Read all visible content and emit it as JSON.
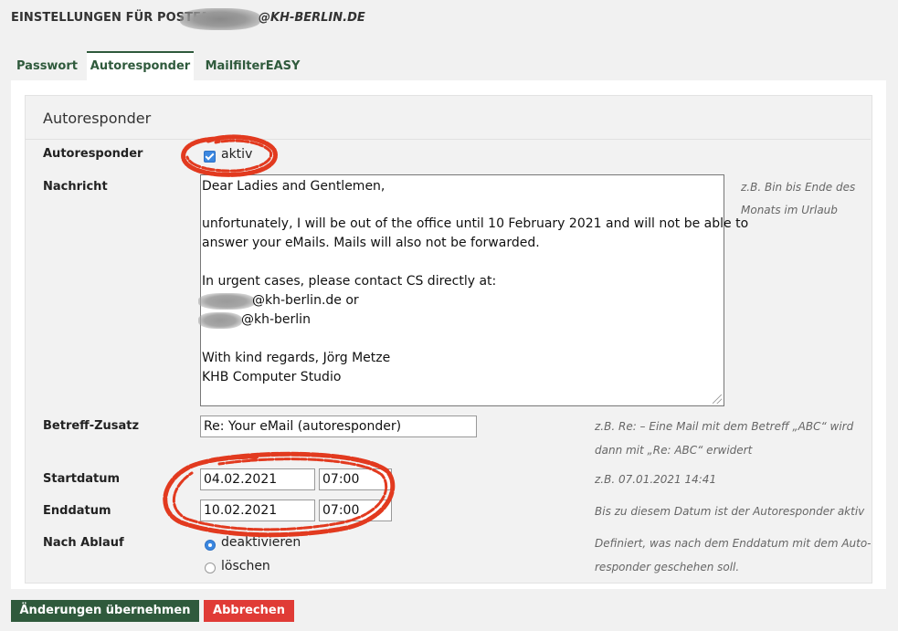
{
  "header": {
    "title": "EINSTELLUNGEN FÜR POSTFACH",
    "domain": "@KH-BERLIN.DE"
  },
  "tabs": [
    {
      "label": "Passwort"
    },
    {
      "label": "Autoresponder"
    },
    {
      "label": "MailfilterEASY"
    }
  ],
  "active_tab": "Autoresponder",
  "panel": {
    "title": "Autoresponder"
  },
  "form": {
    "autoresponder": {
      "label": "Autoresponder",
      "checkbox_label": "aktiv",
      "checked": true
    },
    "message": {
      "label": "Nachricht",
      "lines": [
        "Dear Ladies and Gentlemen,",
        "",
        "unfortunately, I will be out of the office until 10 February 2021 and will not be able to",
        "answer your eMails. Mails will also not be forwarded.",
        "",
        "In urgent cases, please contact CS directly at:",
        "@kh-berlin.de or",
        "@kh-berlin",
        "",
        "With kind regards, Jörg Metze",
        "KHB Computer Studio"
      ],
      "hint_line1": "z.B. Bin bis Ende des",
      "hint_line2": "Monats im Urlaub"
    },
    "subject": {
      "label": "Betreff-Zusatz",
      "value": "Re: Your eMail (autoresponder)",
      "hint_line1": "z.B. Re: – Eine Mail mit dem Betreff „ABC“ wird",
      "hint_line2": "dann mit „Re: ABC“ erwidert"
    },
    "start": {
      "label": "Startdatum",
      "date": "04.02.2021",
      "time": "07:00",
      "hint": "z.B. 07.01.2021 14:41"
    },
    "end": {
      "label": "Enddatum",
      "date": "10.02.2021",
      "time": "07:00",
      "hint": "Bis zu diesem Datum ist der Autoresponder aktiv"
    },
    "after": {
      "label": "Nach Ablauf",
      "options": [
        "deaktivieren",
        "löschen"
      ],
      "selected": "deaktivieren",
      "hint_line1": "Definiert, was nach dem Enddatum mit dem Auto-",
      "hint_line2": "responder geschehen soll."
    }
  },
  "buttons": {
    "save": "Änderungen übernehmen",
    "cancel": "Abbrechen"
  },
  "colors": {
    "accent_green": "#2f5a3c",
    "cancel_red": "#e03b36",
    "annotation_red": "#e23a1f",
    "checkbox_blue": "#3b87e0"
  }
}
